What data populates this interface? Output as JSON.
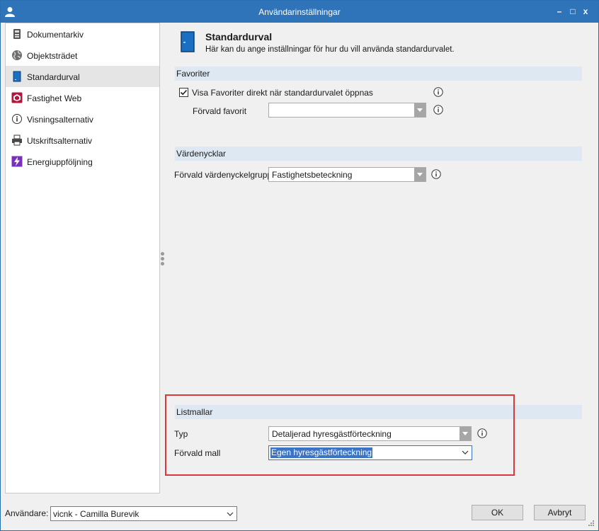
{
  "window": {
    "title": "Användarinställningar"
  },
  "titlebar_controls": {
    "minimize": "–",
    "maximize": "□",
    "close": "x"
  },
  "nav": {
    "items": [
      {
        "label": "Dokumentarkiv",
        "icon": "document-archive-icon"
      },
      {
        "label": "Objektsträdet",
        "icon": "globe-icon"
      },
      {
        "label": "Standardurval",
        "icon": "door-icon",
        "active": true
      },
      {
        "label": "Fastighet Web",
        "icon": "fastighet-web-icon"
      },
      {
        "label": "Visningsalternativ",
        "icon": "info-icon"
      },
      {
        "label": "Utskriftsalternativ",
        "icon": "printer-icon"
      },
      {
        "label": "Energiuppföljning",
        "icon": "energy-icon"
      }
    ]
  },
  "header": {
    "title": "Standardurval",
    "description": "Här kan du ange inställningar för hur du vill använda standardurvalet."
  },
  "favoriter": {
    "section_title": "Favoriter",
    "checkbox_label": "Visa Favoriter direkt när standardurvalet öppnas",
    "checkbox_checked": true,
    "default_label": "Förvald favorit",
    "default_value": ""
  },
  "vardenycklar": {
    "section_title": "Värdenycklar",
    "group_label": "Förvald värdenyckelgrupp",
    "group_value": "Fastighetsbeteckning"
  },
  "listmallar": {
    "section_title": "Listmallar",
    "type_label": "Typ",
    "type_value": "Detaljerad hyresgästförteckning",
    "template_label": "Förvald mall",
    "template_value": "Egen hyresgästförteckning"
  },
  "footer": {
    "user_label": "Användare:",
    "user_value": "vicnk - Camilla Burevik",
    "ok_label": "OK",
    "cancel_label": "Avbryt"
  },
  "colors": {
    "titlebar": "#2f73b8",
    "section_header": "#dde8f3",
    "highlight_border": "#d9393b",
    "selection": "#3b74c5"
  }
}
